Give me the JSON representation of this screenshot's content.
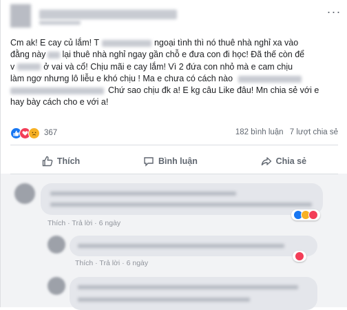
{
  "post": {
    "lines": [
      {
        "a": "Cm ak! E cay củ lắm! T",
        "b": "ngoại tình thì nó thuê nhà nghỉ xa vào"
      },
      {
        "a": "đằng này",
        "b": "lại thuê nhà nghỉ ngay gần chỗ e đưa con đi học! Đã thế còn để"
      },
      {
        "a": "v",
        "b": "ở vai và cổ! Chịu mãi e cay lắm! Vì 2 đứa con nhỏ mà e cam chịu"
      },
      {
        "a": "làm ngơ nhưng lô liễu e khó chịu ! Ma e chưa có cách nào",
        "b": ""
      },
      {
        "a": "",
        "b": "Chứ sao chịu đk a! E kg câu Like đâu! Mn chia sẻ với e"
      },
      {
        "a": "hay bày cách cho e với a!",
        "b": ""
      }
    ]
  },
  "reactions": {
    "count": "367",
    "comments": "182 bình luận",
    "shares": "7 lượt chia sẻ",
    "colors": {
      "like": "#1877f2",
      "love": "#f33e58",
      "sad": "#f7b125"
    }
  },
  "actions": {
    "like": "Thích",
    "comment": "Bình luận",
    "share": "Chia sẻ"
  },
  "comment_meta": {
    "like": "Thích",
    "reply": "Trả lời",
    "time": "6 ngày"
  }
}
